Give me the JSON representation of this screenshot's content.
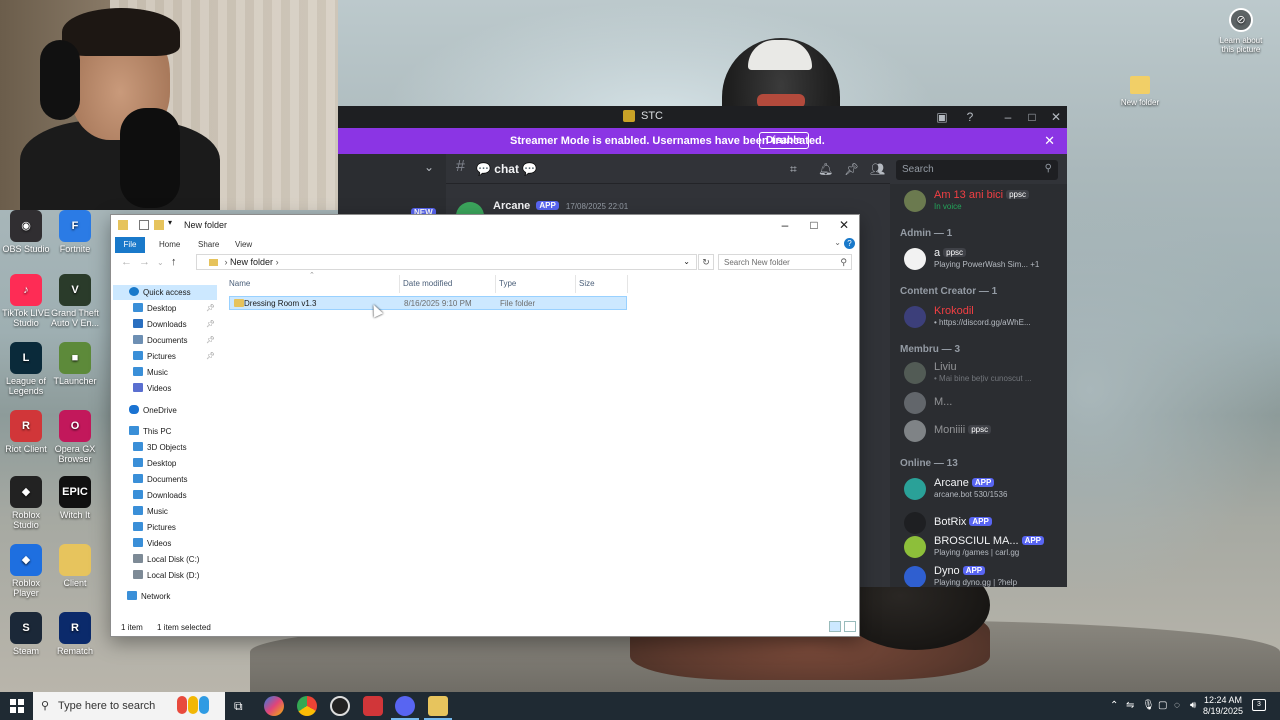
{
  "desktop": {
    "left_icons": [
      {
        "label": "OBS Studio",
        "color": "#302e31",
        "glyph": "◉"
      },
      {
        "label": "Fortnite",
        "color": "#2b7be5",
        "glyph": "F"
      },
      {
        "label": "TikTok LIVE Studio",
        "color": "#fe2c55",
        "glyph": "♪"
      },
      {
        "label": "Grand Theft Auto V En...",
        "color": "#2a3b2a",
        "glyph": "V"
      },
      {
        "label": "League of Legends",
        "color": "#0a2a3a",
        "glyph": "L"
      },
      {
        "label": "TLauncher",
        "color": "#5d8a3a",
        "glyph": "■"
      },
      {
        "label": "Riot Client",
        "color": "#d13639",
        "glyph": "R"
      },
      {
        "label": "Opera GX Browser",
        "color": "#c2185b",
        "glyph": "O"
      },
      {
        "label": "Roblox Studio",
        "color": "#222",
        "glyph": "◆"
      },
      {
        "label": "Witch It",
        "color": "#111",
        "glyph": "EPIC"
      },
      {
        "label": "Roblox Player",
        "color": "#1e6fe0",
        "glyph": "◆"
      },
      {
        "label": "Client",
        "color": "#e7c45d",
        "glyph": ""
      },
      {
        "label": "Steam",
        "color": "#1b2838",
        "glyph": "S"
      },
      {
        "label": "Rematch",
        "color": "#0b2a6b",
        "glyph": "R"
      }
    ],
    "learn_label": "Learn about this picture",
    "new_folder_label": "New folder"
  },
  "discord": {
    "window_title": "STC",
    "streamer_message": "Streamer Mode is enabled. Usernames have been truncated.",
    "disable_label": "Disable",
    "channel_name": "chat",
    "search_placeholder": "Search",
    "message": {
      "author": "Arcane",
      "badge": "APP",
      "timestamp": "17/08/2025 22:01",
      "new_label": "NEW"
    },
    "members": {
      "top": {
        "name": "Am 13 ani bici",
        "tag": "ppsc",
        "status": "In voice"
      },
      "admin_header": "Admin — 1",
      "admin": {
        "name": "a",
        "tag": "ppsc",
        "status": "Playing PowerWash Sim...",
        "extra": "+1"
      },
      "creator_header": "Content Creator — 1",
      "creator": {
        "name": "Krokodil",
        "status": "• https://discord.gg/aWhE..."
      },
      "membru_header": "Membru — 3",
      "membru": [
        {
          "name": "Liviu",
          "status": "• Mai bine bețiv cunoscut ..."
        },
        {
          "name": "M...",
          "status": ""
        },
        {
          "name": "Moniiii",
          "tag": "ppsc",
          "status": ""
        }
      ],
      "online_header": "Online — 13",
      "online": [
        {
          "name": "Arcane",
          "badge": "APP",
          "status": "arcane.bot 530/1536"
        },
        {
          "name": "BotRix",
          "badge": "APP",
          "status": ""
        },
        {
          "name": "BROSCIUL MA...",
          "badge": "APP",
          "status": "Playing /games | carl.gg"
        },
        {
          "name": "Dyno",
          "badge": "APP",
          "status": "Playing dyno.gg | ?help"
        }
      ]
    }
  },
  "explorer": {
    "title": "New folder",
    "ribbon_tabs": [
      "File",
      "Home",
      "Share",
      "View"
    ],
    "breadcrumb": "New folder",
    "search_placeholder": "Search New folder",
    "nav": {
      "quick_access": "Quick access",
      "quick_items": [
        "Desktop",
        "Downloads",
        "Documents",
        "Pictures",
        "Music",
        "Videos"
      ],
      "onedrive": "OneDrive",
      "this_pc": "This PC",
      "pc_items": [
        "3D Objects",
        "Desktop",
        "Documents",
        "Downloads",
        "Music",
        "Pictures",
        "Videos",
        "Local Disk (C:)",
        "Local Disk (D:)"
      ],
      "network": "Network"
    },
    "columns": [
      "Name",
      "Date modified",
      "Type",
      "Size"
    ],
    "rows": [
      {
        "name": "Dressing Room v1.3",
        "date": "8/16/2025 9:10 PM",
        "type": "File folder",
        "size": ""
      }
    ],
    "status_count": "1 item",
    "status_selected": "1 item selected"
  },
  "taskbar": {
    "search_placeholder": "Type here to search",
    "time": "12:24 AM",
    "date": "8/19/2025"
  }
}
